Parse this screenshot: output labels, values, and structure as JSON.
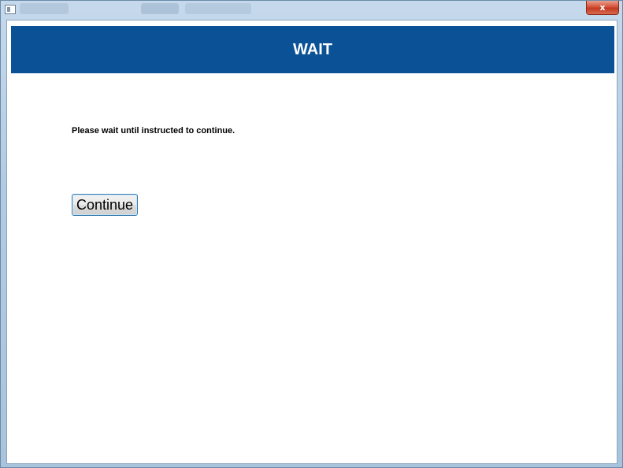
{
  "window": {
    "close_label": "x"
  },
  "header": {
    "title": "WAIT"
  },
  "main": {
    "instruction": "Please wait until instructed to continue.",
    "continue_label": "Continue"
  },
  "colors": {
    "header_bg": "#0a5196",
    "header_text": "#ffffff",
    "close_button": "#c23a21"
  }
}
